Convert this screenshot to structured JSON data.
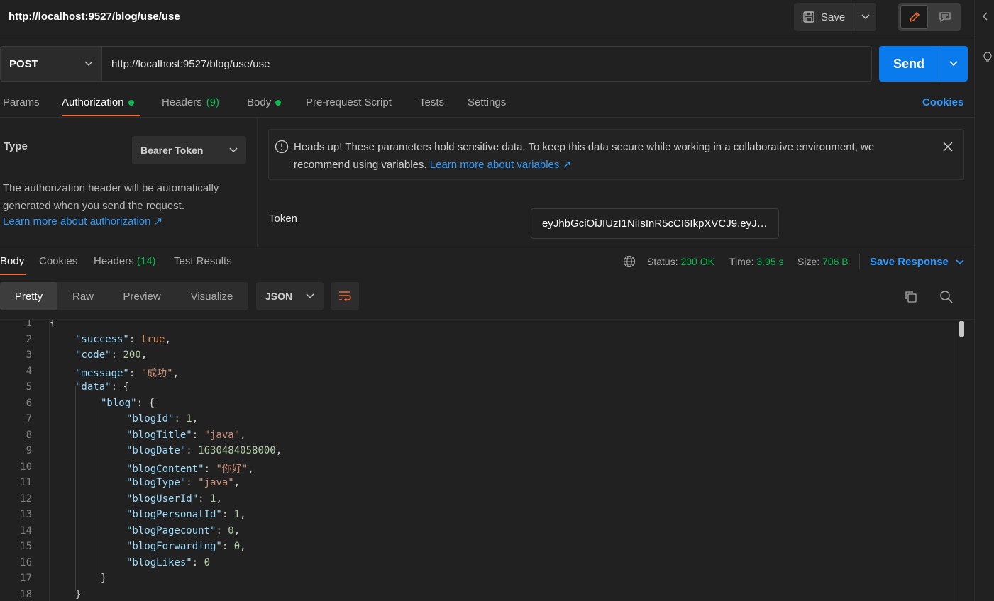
{
  "header": {
    "title": "http://localhost:9527/blog/use/use",
    "save_label": "Save"
  },
  "request": {
    "method": "POST",
    "url": "http://localhost:9527/blog/use/use",
    "send_label": "Send"
  },
  "tabs": {
    "params": "Params",
    "authorization": "Authorization",
    "headers": "Headers",
    "headers_count": "(9)",
    "body": "Body",
    "prerequest": "Pre-request Script",
    "tests": "Tests",
    "settings": "Settings",
    "cookies": "Cookies"
  },
  "auth": {
    "type_label": "Type",
    "type_value": "Bearer Token",
    "description": "The authorization header will be automatically generated when you send the request.",
    "learn_more": "Learn more about authorization ↗",
    "notice_text": "Heads up! These parameters hold sensitive data. To keep this data secure while working in a collaborative environment, we recommend using variables.",
    "notice_link": "Learn more about variables ↗",
    "token_label": "Token",
    "token_value": "eyJhbGciOiJIUzI1NiIsInR5cCI6IkpXVCJ9.eyJ…"
  },
  "response": {
    "tabs": {
      "body": "Body",
      "cookies": "Cookies",
      "headers": "Headers",
      "headers_count": "(14)",
      "test_results": "Test Results"
    },
    "status_label": "Status:",
    "status_value": "200 OK",
    "time_label": "Time:",
    "time_value": "3.95 s",
    "size_label": "Size:",
    "size_value": "706 B",
    "save_response": "Save Response",
    "views": [
      "Pretty",
      "Raw",
      "Preview",
      "Visualize"
    ],
    "format": "JSON"
  },
  "code_lines": [
    {
      "n": "1"
    },
    {
      "n": "2"
    },
    {
      "n": "3"
    },
    {
      "n": "4"
    },
    {
      "n": "5"
    },
    {
      "n": "6"
    },
    {
      "n": "7"
    },
    {
      "n": "8"
    },
    {
      "n": "9"
    },
    {
      "n": "10"
    },
    {
      "n": "11"
    },
    {
      "n": "12"
    },
    {
      "n": "13"
    },
    {
      "n": "14"
    },
    {
      "n": "15"
    },
    {
      "n": "16"
    },
    {
      "n": "17"
    },
    {
      "n": "18"
    }
  ],
  "code": {
    "l1": "{",
    "k_success": "\"success\"",
    "v_success": "true",
    "k_code": "\"code\"",
    "v_code": "200",
    "k_message": "\"message\"",
    "v_message": "\"成功\"",
    "k_data": "\"data\"",
    "open_brace": "{",
    "k_blog": "\"blog\"",
    "k_blogId": "\"blogId\"",
    "v_blogId": "1",
    "k_blogTitle": "\"blogTitle\"",
    "v_blogTitle": "\"java\"",
    "k_blogDate": "\"blogDate\"",
    "v_blogDate": "1630484058000",
    "k_blogContent": "\"blogContent\"",
    "v_blogContent": "\"你好\"",
    "k_blogType": "\"blogType\"",
    "v_blogType": "\"java\"",
    "k_blogUserId": "\"blogUserId\"",
    "v_blogUserId": "1",
    "k_blogPersonalId": "\"blogPersonalId\"",
    "v_blogPersonalId": "1",
    "k_blogPagecount": "\"blogPagecount\"",
    "v_blogPagecount": "0",
    "k_blogForwarding": "\"blogForwarding\"",
    "v_blogForwarding": "0",
    "k_blogLikes": "\"blogLikes\"",
    "v_blogLikes": "0",
    "close_brace": "}"
  }
}
